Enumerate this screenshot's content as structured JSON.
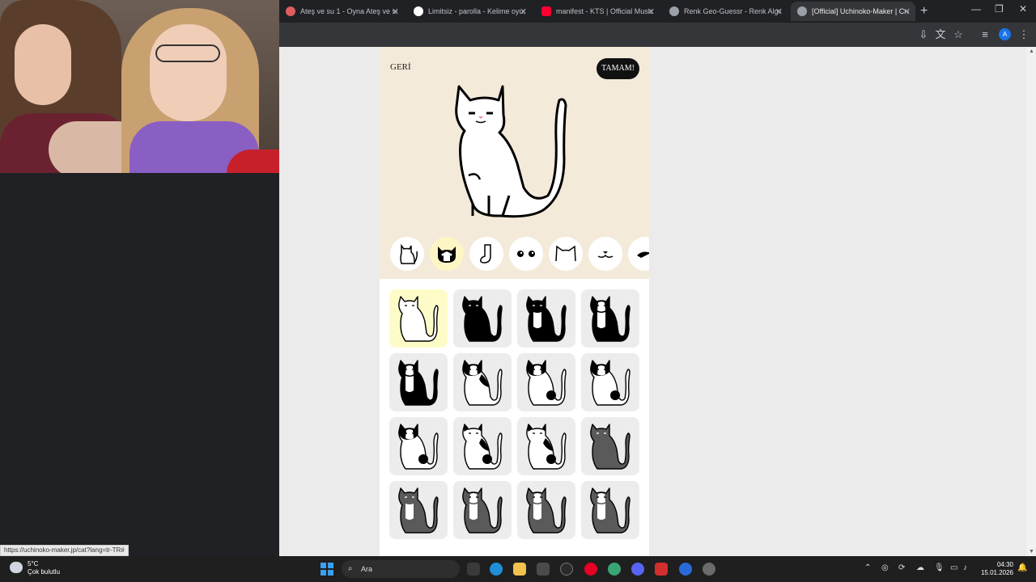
{
  "browser": {
    "tabs": [
      {
        "title": "Ateş ve su 1 - Oyna Ateş ve su",
        "color": "#e05d5d",
        "active": false
      },
      {
        "title": "Limitsiz - parolla - Kelime oyun",
        "color": "#ffffff",
        "active": false
      },
      {
        "title": "manifest - KTS | Official Music V",
        "color": "#ff0033",
        "active": false
      },
      {
        "title": "Renk Geo-Guessr - Renk Algıla",
        "color": "#9aa0a6",
        "active": false
      },
      {
        "title": "[Official] Uchinoko-Maker | Cre",
        "color": "#9aa0a6",
        "active": true
      }
    ],
    "new_tab": "+",
    "profile_initial": "A",
    "status_url": "https://uchinoko-maker.jp/cat?lang=tr-TR#"
  },
  "app": {
    "back_label": "GERİ",
    "ok_label": "TAMAM!",
    "categories": [
      {
        "name": "body-shape",
        "selected": false
      },
      {
        "name": "coat-pattern",
        "selected": true
      },
      {
        "name": "socks",
        "selected": false
      },
      {
        "name": "eyes",
        "selected": false
      },
      {
        "name": "ears",
        "selected": false
      },
      {
        "name": "mouth",
        "selected": false
      },
      {
        "name": "accessory",
        "selected": false
      }
    ],
    "patterns": [
      {
        "id": "white",
        "selected": true
      },
      {
        "id": "black"
      },
      {
        "id": "black-white-chest"
      },
      {
        "id": "tuxedo"
      },
      {
        "id": "tuxedo-white-face"
      },
      {
        "id": "black-back-patch"
      },
      {
        "id": "white-black-spots"
      },
      {
        "id": "white-black-spots-2"
      },
      {
        "id": "bicolor-1"
      },
      {
        "id": "bicolor-2"
      },
      {
        "id": "bicolor-3"
      },
      {
        "id": "gray"
      },
      {
        "id": "gray-white-chest"
      },
      {
        "id": "gray-white-face"
      },
      {
        "id": "gray-bicolor"
      },
      {
        "id": "gray-white-spots"
      }
    ]
  },
  "taskbar": {
    "temperature": "5°C",
    "weather": "Çok bulutlu",
    "search_placeholder": "Ara",
    "time": "04:30",
    "date": "15.01.2026"
  }
}
